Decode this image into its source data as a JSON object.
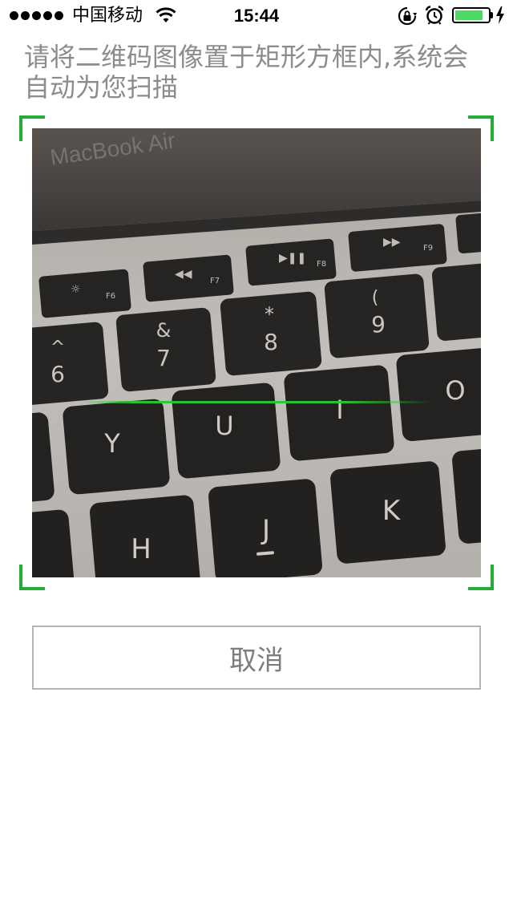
{
  "status_bar": {
    "carrier": "中国移动",
    "time": "15:44",
    "battery_level": 0.85,
    "signal_bars": 5,
    "icons": [
      "wifi-icon",
      "rotation-lock-icon",
      "alarm-icon",
      "battery-icon",
      "charging-icon"
    ]
  },
  "instruction": "请将二维码图像置于矩形方框内,系统会自动为您扫描",
  "scanner": {
    "accent_color": "#22ac38",
    "scan_line_color": "#28c832",
    "preview": {
      "laptop_label": "MacBook Air",
      "function_keys": [
        "F6",
        "F7",
        "F8",
        "F9"
      ],
      "number_keys": [
        {
          "top": "^",
          "bottom": "6"
        },
        {
          "top": "&",
          "bottom": "7"
        },
        {
          "top": "*",
          "bottom": "8"
        },
        {
          "top": "(",
          "bottom": "9"
        }
      ],
      "letter_keys_row1": [
        "Y",
        "U",
        "I",
        "O"
      ],
      "letter_keys_row2": [
        "H",
        "J",
        "K"
      ]
    }
  },
  "cancel_button": {
    "label": "取消"
  }
}
